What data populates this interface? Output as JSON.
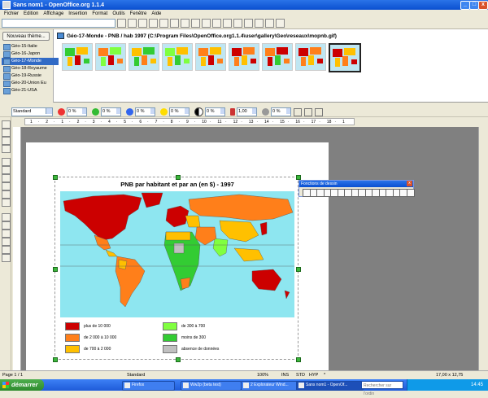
{
  "window": {
    "title": "Sans nom1 - OpenOffice.org 1.1.4",
    "buttons": [
      "_",
      "□",
      "x"
    ]
  },
  "menu": [
    "Fichier",
    "Edition",
    "Affichage",
    "Insertion",
    "Format",
    "Outils",
    "Fenêtre",
    "Aide"
  ],
  "gallery": {
    "new_theme_button": "Nouveau thème...",
    "themes": [
      "Géo-15-Italie",
      "Géo-16-Japon",
      "Géo-17-Monde",
      "Géo-18-Royaume",
      "Géo-19-Russie",
      "Géo-20-Union Eu",
      "Géo-21-USA"
    ],
    "selected_theme": "Géo-17-Monde",
    "path": "Géo-17-Monde - PNB / hab 1997 (C:\\Program Files\\OpenOffice.org1.1.4\\user\\gallery\\Geo\\reseaux\\mopnb.gif)",
    "thumbnail_count": 9
  },
  "format_toolbar": {
    "style": "Standard",
    "percents": [
      "0 %",
      "0 %",
      "0 %",
      "0 %",
      "0 %",
      "0 %"
    ],
    "gamma": "1,00",
    "transparency": "0 %"
  },
  "ruler": {
    "ticks": [
      "1",
      "·",
      "2",
      "·",
      "1",
      "·",
      "2",
      "·",
      "3",
      "·",
      "4",
      "·",
      "5",
      "·",
      "6",
      "·",
      "7",
      "·",
      "8",
      "·",
      "9",
      "·",
      "10",
      "·",
      "11",
      "·",
      "12",
      "·",
      "13",
      "·",
      "14",
      "·",
      "15",
      "·",
      "16",
      "·",
      "17",
      "·",
      "18",
      "·",
      "1"
    ]
  },
  "map": {
    "title": "PNB par habitant et par an (en $) - 1997",
    "legend": [
      {
        "label": "plus de 10 000",
        "color": "#cc0000"
      },
      {
        "label": "de 2 000 à 10 000",
        "color": "#ff7f1a"
      },
      {
        "label": "de 700 à 2 000",
        "color": "#ffc000"
      },
      {
        "label": "de 300 à 700",
        "color": "#80ff40"
      },
      {
        "label": "moins de 300",
        "color": "#33cc33"
      },
      {
        "label": "absence de données",
        "color": "#c0c0c0"
      }
    ],
    "ocean_color": "#8ee6f0"
  },
  "draw_toolbar": {
    "title": "Fonctions de dessin",
    "close": "x",
    "icon_count": 16
  },
  "status": {
    "page": "Page 1 / 1",
    "style": "Standard",
    "zoom": "100%",
    "mode": "INS",
    "std": "STD",
    "hyp": "HYP",
    "star": "*",
    "position": "17,00 x 12,75"
  },
  "taskbar": {
    "start": "démarrer",
    "tasks": [
      "Firefox",
      "Ww2p (beta test)",
      "2 Explorateur Wind...",
      "Sans nom1 - OpenOf..."
    ],
    "active_task": "Sans nom1 - OpenOf...",
    "search_placeholder": "Rechercher sur l'ordin",
    "clock": "14:45"
  }
}
